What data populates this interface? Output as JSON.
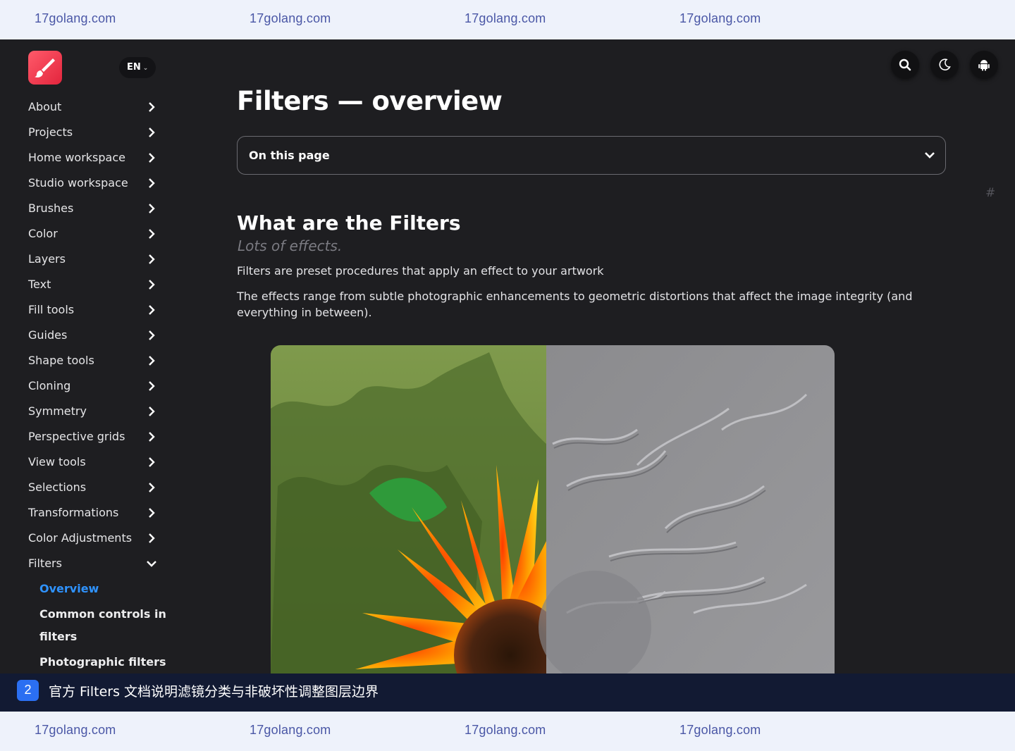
{
  "watermark": {
    "top": [
      "17golang.com",
      "17golang.com",
      "17golang.com",
      "17golang.com"
    ],
    "bottom": [
      "17golang.com",
      "17golang.com",
      "17golang.com",
      "17golang.com"
    ]
  },
  "header": {
    "language": "EN",
    "icons": [
      "search-icon",
      "moon-icon",
      "android-icon"
    ]
  },
  "sidebar": {
    "items": [
      {
        "label": "About"
      },
      {
        "label": "Projects"
      },
      {
        "label": "Home workspace"
      },
      {
        "label": "Studio workspace"
      },
      {
        "label": "Brushes"
      },
      {
        "label": "Color"
      },
      {
        "label": "Layers"
      },
      {
        "label": "Text"
      },
      {
        "label": "Fill tools"
      },
      {
        "label": "Guides"
      },
      {
        "label": "Shape tools"
      },
      {
        "label": "Cloning"
      },
      {
        "label": "Symmetry"
      },
      {
        "label": "Perspective grids"
      },
      {
        "label": "View tools"
      },
      {
        "label": "Selections"
      },
      {
        "label": "Transformations"
      },
      {
        "label": "Color Adjustments"
      },
      {
        "label": "Filters"
      }
    ],
    "subitems": [
      {
        "label": "Overview",
        "active": true
      },
      {
        "label": "Common controls in filters",
        "active": false
      },
      {
        "label": "Photographic filters",
        "active": false
      }
    ]
  },
  "main": {
    "title": "Filters — overview",
    "on_this_page": "On this page",
    "anchor": "#",
    "section_title": "What are the Filters",
    "section_subtitle": "Lots of effects.",
    "paragraph1": "Filters are preset procedures that apply an effect to your artwork",
    "paragraph2": "The effects range from subtle photographic enhancements to geometric distortions that affect the image integrity (and everything in between)."
  },
  "caption": {
    "number": "2",
    "text": "官方 Filters 文档说明滤镜分类与非破坏性调整图层边界"
  },
  "colors": {
    "background": "#1e1e21",
    "accent": "#2f93ff",
    "logo": "#e3253d",
    "caption_bar": "#121a33",
    "watermark_bar": "#eef2fb"
  }
}
